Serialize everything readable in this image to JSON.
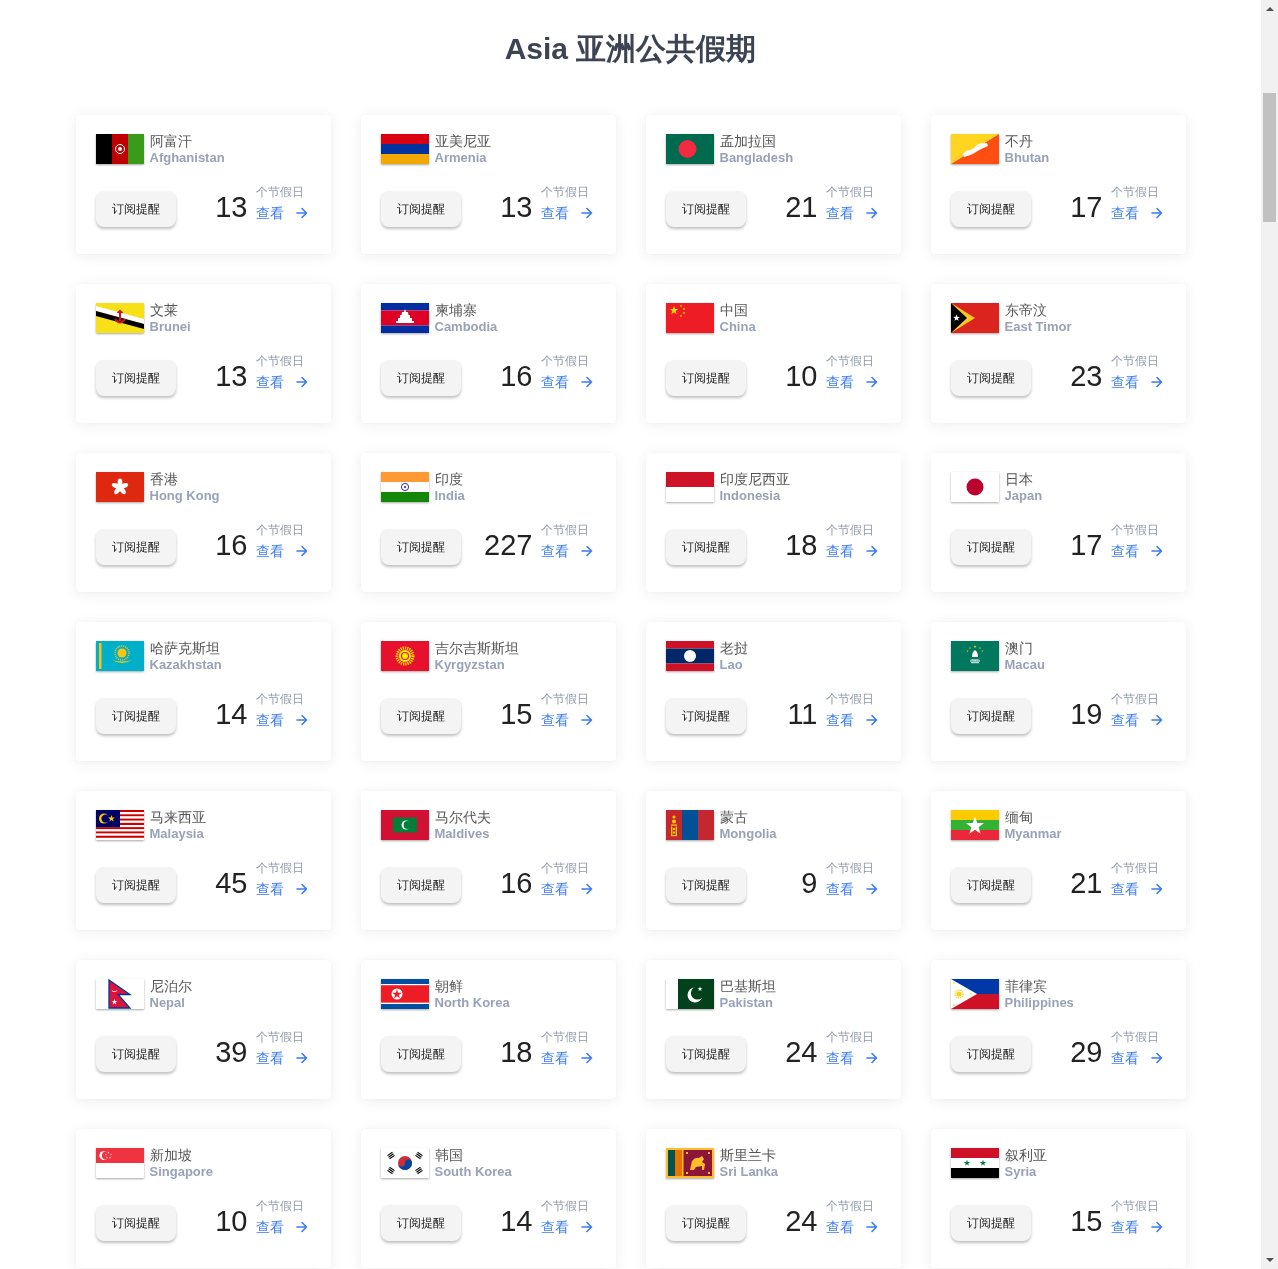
{
  "page": {
    "title": "Asia 亚洲公共假期"
  },
  "countries": [
    {
      "name_zh": "阿富汗",
      "name_en": "Afghanistan",
      "subscribe_button": "订阅提醒",
      "holiday_count": "13",
      "count_label": "个节假日",
      "view_link": "查看"
    },
    {
      "name_zh": "亚美尼亚",
      "name_en": "Armenia",
      "subscribe_button": "订阅提醒",
      "holiday_count": "13",
      "count_label": "个节假日",
      "view_link": "查看"
    },
    {
      "name_zh": "孟加拉国",
      "name_en": "Bangladesh",
      "subscribe_button": "订阅提醒",
      "holiday_count": "21",
      "count_label": "个节假日",
      "view_link": "查看"
    },
    {
      "name_zh": "不丹",
      "name_en": "Bhutan",
      "subscribe_button": "订阅提醒",
      "holiday_count": "17",
      "count_label": "个节假日",
      "view_link": "查看"
    },
    {
      "name_zh": "文莱",
      "name_en": "Brunei",
      "subscribe_button": "订阅提醒",
      "holiday_count": "13",
      "count_label": "个节假日",
      "view_link": "查看"
    },
    {
      "name_zh": "柬埔寨",
      "name_en": "Cambodia",
      "subscribe_button": "订阅提醒",
      "holiday_count": "16",
      "count_label": "个节假日",
      "view_link": "查看"
    },
    {
      "name_zh": "中国",
      "name_en": "China",
      "subscribe_button": "订阅提醒",
      "holiday_count": "10",
      "count_label": "个节假日",
      "view_link": "查看"
    },
    {
      "name_zh": "东帝汶",
      "name_en": "East Timor",
      "subscribe_button": "订阅提醒",
      "holiday_count": "23",
      "count_label": "个节假日",
      "view_link": "查看"
    },
    {
      "name_zh": "香港",
      "name_en": "Hong Kong",
      "subscribe_button": "订阅提醒",
      "holiday_count": "16",
      "count_label": "个节假日",
      "view_link": "查看"
    },
    {
      "name_zh": "印度",
      "name_en": "India",
      "subscribe_button": "订阅提醒",
      "holiday_count": "227",
      "count_label": "个节假日",
      "view_link": "查看"
    },
    {
      "name_zh": "印度尼西亚",
      "name_en": "Indonesia",
      "subscribe_button": "订阅提醒",
      "holiday_count": "18",
      "count_label": "个节假日",
      "view_link": "查看"
    },
    {
      "name_zh": "日本",
      "name_en": "Japan",
      "subscribe_button": "订阅提醒",
      "holiday_count": "17",
      "count_label": "个节假日",
      "view_link": "查看"
    },
    {
      "name_zh": "哈萨克斯坦",
      "name_en": "Kazakhstan",
      "subscribe_button": "订阅提醒",
      "holiday_count": "14",
      "count_label": "个节假日",
      "view_link": "查看"
    },
    {
      "name_zh": "吉尔吉斯斯坦",
      "name_en": "Kyrgyzstan",
      "subscribe_button": "订阅提醒",
      "holiday_count": "15",
      "count_label": "个节假日",
      "view_link": "查看"
    },
    {
      "name_zh": "老挝",
      "name_en": "Lao",
      "subscribe_button": "订阅提醒",
      "holiday_count": "11",
      "count_label": "个节假日",
      "view_link": "查看"
    },
    {
      "name_zh": "澳门",
      "name_en": "Macau",
      "subscribe_button": "订阅提醒",
      "holiday_count": "19",
      "count_label": "个节假日",
      "view_link": "查看"
    },
    {
      "name_zh": "马来西亚",
      "name_en": "Malaysia",
      "subscribe_button": "订阅提醒",
      "holiday_count": "45",
      "count_label": "个节假日",
      "view_link": "查看"
    },
    {
      "name_zh": "马尔代夫",
      "name_en": "Maldives",
      "subscribe_button": "订阅提醒",
      "holiday_count": "16",
      "count_label": "个节假日",
      "view_link": "查看"
    },
    {
      "name_zh": "蒙古",
      "name_en": "Mongolia",
      "subscribe_button": "订阅提醒",
      "holiday_count": "9",
      "count_label": "个节假日",
      "view_link": "查看"
    },
    {
      "name_zh": "缅甸",
      "name_en": "Myanmar",
      "subscribe_button": "订阅提醒",
      "holiday_count": "21",
      "count_label": "个节假日",
      "view_link": "查看"
    },
    {
      "name_zh": "尼泊尔",
      "name_en": "Nepal",
      "subscribe_button": "订阅提醒",
      "holiday_count": "39",
      "count_label": "个节假日",
      "view_link": "查看"
    },
    {
      "name_zh": "朝鲜",
      "name_en": "North Korea",
      "subscribe_button": "订阅提醒",
      "holiday_count": "18",
      "count_label": "个节假日",
      "view_link": "查看"
    },
    {
      "name_zh": "巴基斯坦",
      "name_en": "Pakistan",
      "subscribe_button": "订阅提醒",
      "holiday_count": "24",
      "count_label": "个节假日",
      "view_link": "查看"
    },
    {
      "name_zh": "菲律宾",
      "name_en": "Philippines",
      "subscribe_button": "订阅提醒",
      "holiday_count": "29",
      "count_label": "个节假日",
      "view_link": "查看"
    },
    {
      "name_zh": "新加坡",
      "name_en": "Singapore",
      "subscribe_button": "订阅提醒",
      "holiday_count": "10",
      "count_label": "个节假日",
      "view_link": "查看"
    },
    {
      "name_zh": "韩国",
      "name_en": "South Korea",
      "subscribe_button": "订阅提醒",
      "holiday_count": "14",
      "count_label": "个节假日",
      "view_link": "查看"
    },
    {
      "name_zh": "斯里兰卡",
      "name_en": "Sri Lanka",
      "subscribe_button": "订阅提醒",
      "holiday_count": "24",
      "count_label": "个节假日",
      "view_link": "查看"
    },
    {
      "name_zh": "叙利亚",
      "name_en": "Syria",
      "subscribe_button": "订阅提醒",
      "holiday_count": "15",
      "count_label": "个节假日",
      "view_link": "查看"
    }
  ]
}
